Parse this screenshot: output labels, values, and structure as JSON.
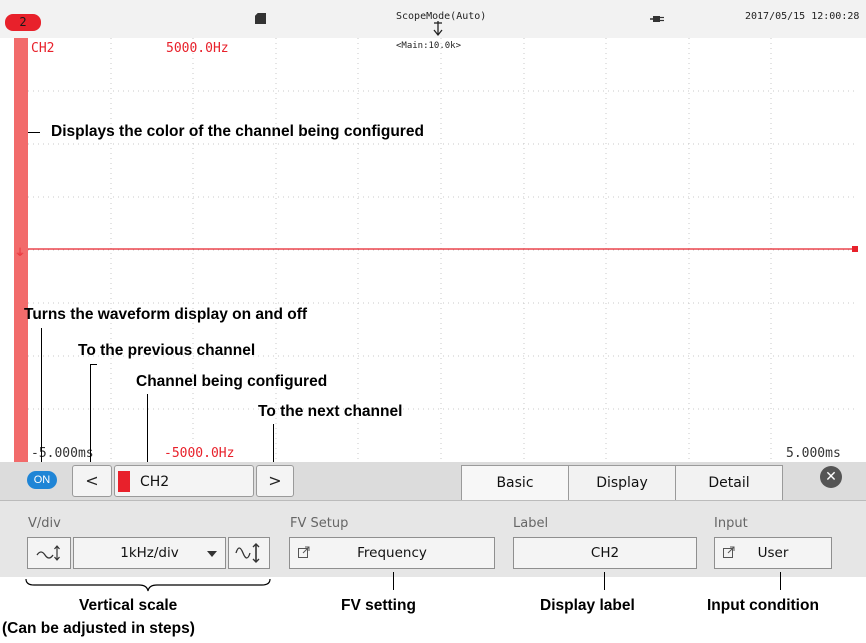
{
  "status_bar": {
    "channel_tab": "2",
    "mode": "ScopeMode(Auto)",
    "datetime": "2017/05/15 12:00:28"
  },
  "waveform": {
    "channel_label": "CH2",
    "frequency": "5000.0Hz",
    "main_record": "<Main:10.0k>",
    "x_min": "-5.000ms",
    "y_min": "-5000.0Hz",
    "x_max": "5.000ms",
    "channel_color": "#e8212b",
    "bar_color": "#f26b6b"
  },
  "annotations": {
    "color_bar": "Displays the color of the channel being configured",
    "display_toggle": "Turns the waveform display on and off",
    "prev_channel": "To the previous channel",
    "channel_being_configured": "Channel being configured",
    "next_channel": "To the next channel",
    "vertical_scale_1": "Vertical scale",
    "vertical_scale_2": "(Can be adjusted in steps)",
    "fv_setting": "FV setting",
    "display_label": "Display label",
    "input_condition": "Input condition"
  },
  "panel": {
    "on_toggle": "ON",
    "prev_icon": "<",
    "next_icon": ">",
    "selected_channel": "CH2",
    "tabs": [
      {
        "label": "Basic"
      },
      {
        "label": "Display"
      },
      {
        "label": "Detail"
      }
    ],
    "vdiv": {
      "group_label": "V/div",
      "value": "1kHz/div"
    },
    "fv_setup": {
      "group_label": "FV Setup",
      "value": "Frequency"
    },
    "label": {
      "group_label": "Label",
      "value": "CH2"
    },
    "input": {
      "group_label": "Input",
      "value": "User"
    },
    "icons": {
      "sd_card": "sd-card-icon",
      "power": "power-plug-icon",
      "close": "close-icon",
      "external": "external-open-icon",
      "fine_adjust": "fine-adjust-wave-icon",
      "coarse_adjust": "coarse-adjust-wave-icon"
    },
    "accent_color": "#1f85d6"
  }
}
